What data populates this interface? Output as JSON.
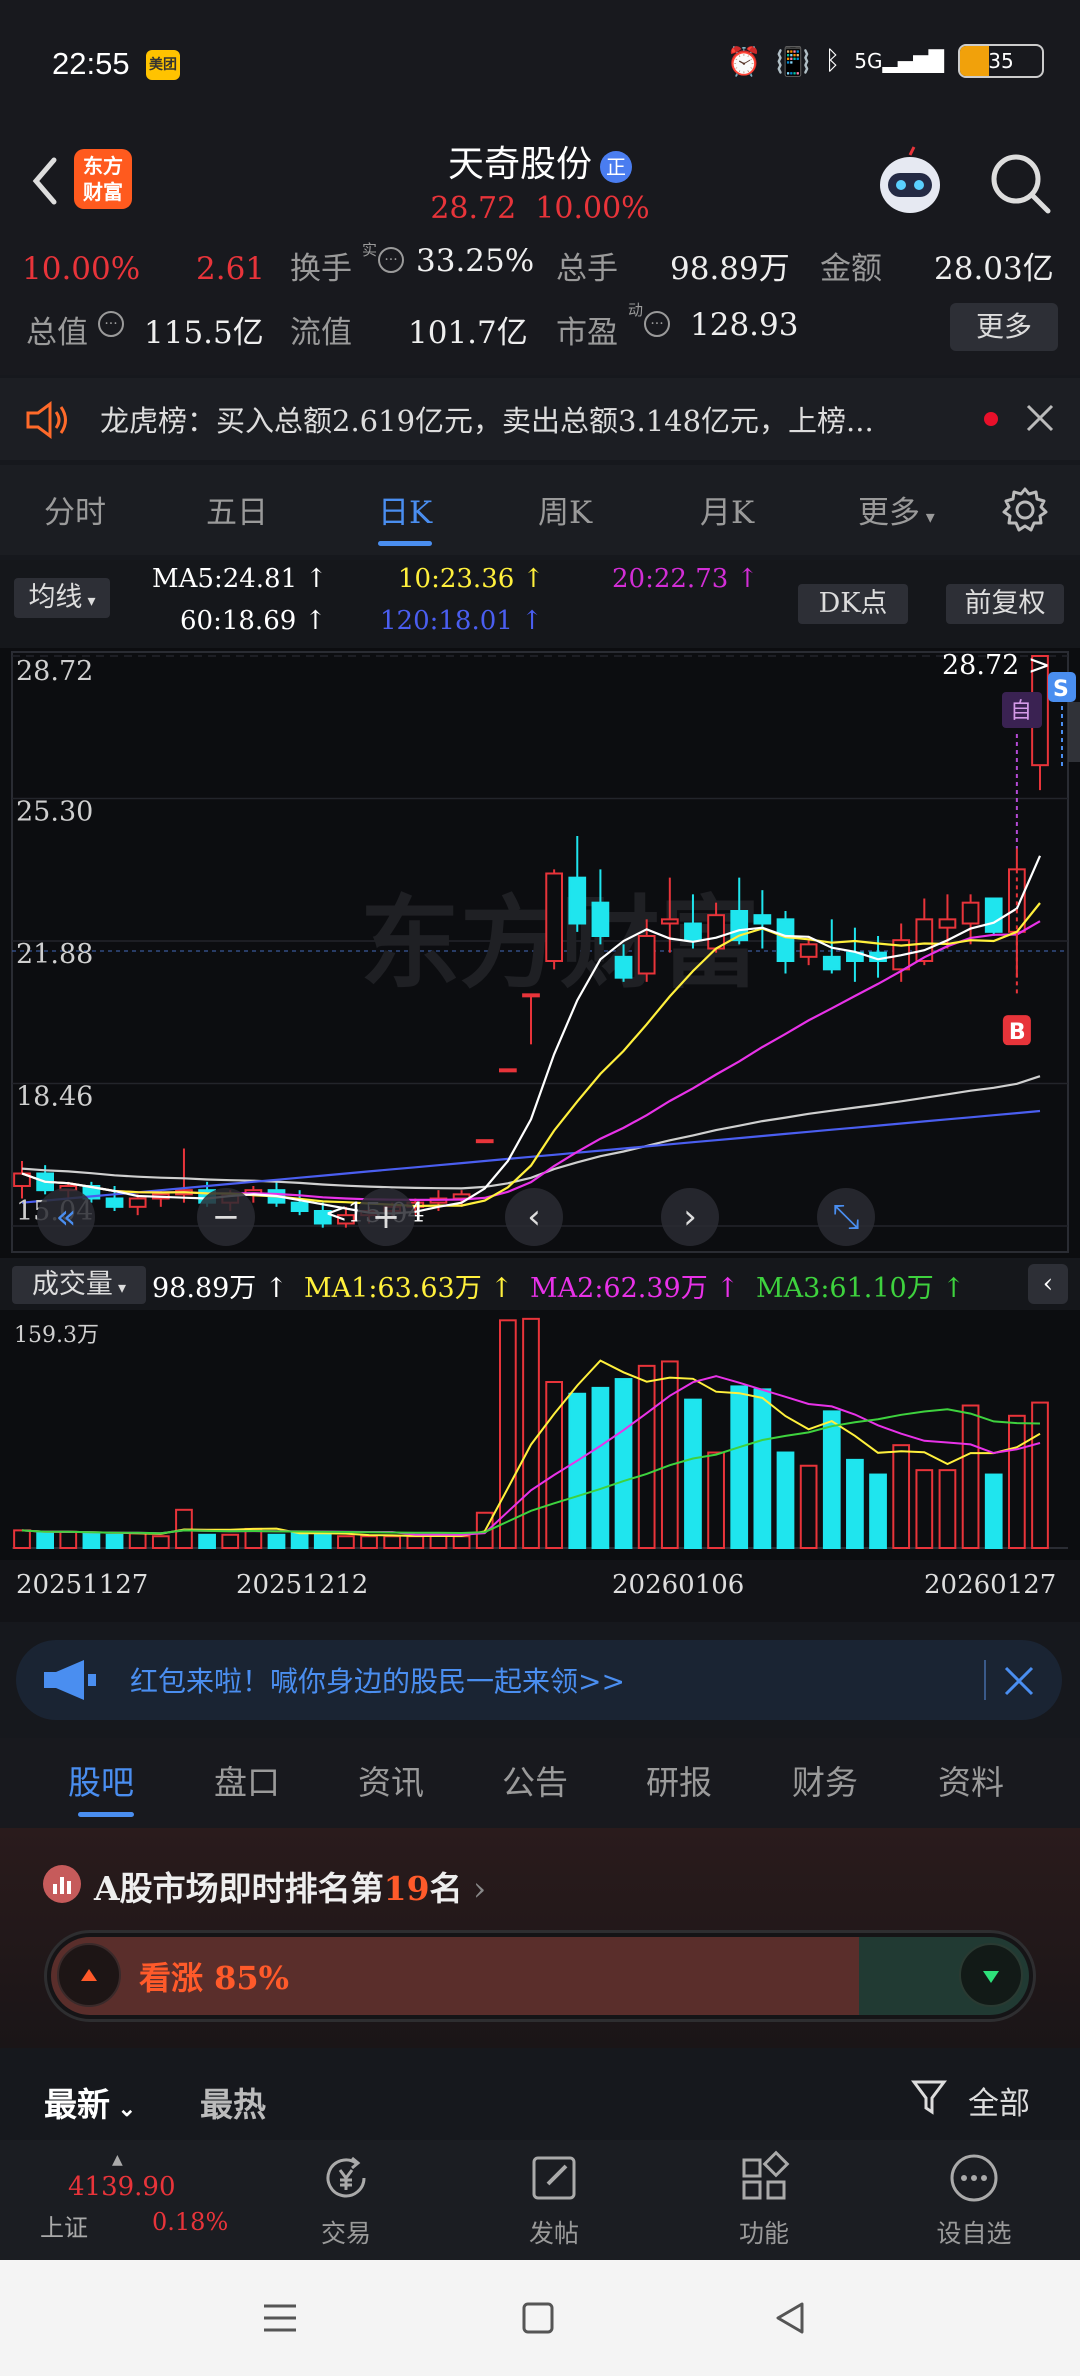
{
  "status": {
    "time": "22:55",
    "meituan": "美团",
    "network": "5G",
    "battery": "35"
  },
  "header": {
    "app_logo": "东方财富",
    "stock_name": "天奇股份",
    "badge": "正",
    "price": "28.72",
    "change_pct": "10.00%"
  },
  "quote": {
    "change_pct": "10.00%",
    "change": "2.61",
    "turnover_label": "换手",
    "turnover_sup": "实",
    "turnover": "33.25%",
    "volume_label": "总手",
    "volume": "98.89万",
    "amount_label": "金额",
    "amount": "28.03亿",
    "mktcap_label": "总值",
    "mktcap": "115.5亿",
    "float_label": "流值",
    "float": "101.7亿",
    "pe_label": "市盈",
    "pe_sup": "动",
    "pe": "128.93",
    "more": "更多"
  },
  "notice": {
    "text": "龙虎榜：买入总额2.619亿元，卖出总额3.148亿元，上榜..."
  },
  "tabs": [
    "分时",
    "五日",
    "日K",
    "周K",
    "月K",
    "更多"
  ],
  "active_tab": "日K",
  "ma": {
    "selector": "均线",
    "ma5": "MA5:24.81 ↑",
    "ma10": "10:23.36 ↑",
    "ma20": "20:22.73 ↑",
    "ma60": "60:18.69 ↑",
    "ma120": "120:18.01 ↑",
    "dk": "DK点",
    "adjust": "前复权"
  },
  "colors": {
    "ma5": "#ffffff",
    "ma10": "#fff03c",
    "ma20": "#e832e8",
    "ma60": "#cfcfcf",
    "ma120": "#4a5ef0",
    "up": "#e8343a",
    "down": "#1fe5ee",
    "vol_ma3": "#3ed23e"
  },
  "chart_data": [
    {
      "type": "candlestick",
      "y_ticks": [
        "28.72",
        "25.30",
        "21.88",
        "18.46",
        "15.04"
      ],
      "ylim": [
        15.04,
        28.72
      ],
      "last_price_label": "28.72",
      "low_label": "15.04",
      "badge_s": "S",
      "badge_b": "B",
      "badge_zi": "自",
      "candles": [
        [
          16.0,
          16.6,
          15.7,
          16.3
        ],
        [
          16.3,
          16.5,
          15.8,
          15.9
        ],
        [
          15.9,
          16.1,
          15.7,
          16.0
        ],
        [
          16.0,
          16.1,
          15.6,
          15.7
        ],
        [
          15.7,
          16.0,
          15.4,
          15.5
        ],
        [
          15.5,
          15.8,
          15.3,
          15.7
        ],
        [
          15.7,
          15.9,
          15.5,
          15.8
        ],
        [
          15.8,
          16.9,
          15.6,
          15.9
        ],
        [
          15.9,
          16.1,
          15.5,
          15.6
        ],
        [
          15.6,
          15.9,
          15.4,
          15.8
        ],
        [
          15.8,
          16.0,
          15.6,
          15.9
        ],
        [
          15.9,
          16.1,
          15.5,
          15.6
        ],
        [
          15.6,
          15.9,
          15.3,
          15.4
        ],
        [
          15.4,
          15.6,
          15.0,
          15.1
        ],
        [
          15.1,
          15.5,
          15.0,
          15.3
        ],
        [
          15.3,
          15.5,
          15.1,
          15.4
        ],
        [
          15.4,
          15.6,
          15.2,
          15.5
        ],
        [
          15.5,
          15.7,
          15.3,
          15.6
        ],
        [
          15.6,
          15.9,
          15.4,
          15.7
        ],
        [
          15.7,
          15.9,
          15.5,
          15.8
        ],
        [
          17.1,
          17.1,
          17.1,
          17.1
        ],
        [
          18.8,
          18.8,
          18.8,
          18.8
        ],
        [
          20.6,
          20.6,
          19.4,
          20.6
        ],
        [
          21.4,
          23.6,
          21.2,
          23.5
        ],
        [
          23.4,
          24.4,
          22.1,
          22.3
        ],
        [
          22.8,
          23.6,
          21.8,
          22.0
        ],
        [
          21.5,
          21.8,
          20.9,
          21.0
        ],
        [
          21.1,
          22.4,
          20.9,
          22.0
        ],
        [
          22.3,
          23.4,
          21.6,
          22.4
        ],
        [
          22.3,
          23.0,
          21.7,
          21.9
        ],
        [
          21.7,
          22.8,
          21.6,
          22.5
        ],
        [
          22.6,
          23.4,
          21.8,
          21.9
        ],
        [
          22.5,
          23.1,
          21.7,
          22.3
        ],
        [
          22.4,
          22.6,
          21.1,
          21.4
        ],
        [
          21.5,
          22.0,
          21.3,
          21.8
        ],
        [
          21.5,
          22.4,
          21.1,
          21.2
        ],
        [
          21.6,
          22.2,
          20.9,
          21.4
        ],
        [
          21.6,
          22.0,
          21.0,
          21.4
        ],
        [
          21.2,
          22.3,
          20.9,
          21.9
        ],
        [
          21.4,
          22.9,
          21.3,
          22.4
        ],
        [
          22.2,
          23.0,
          21.7,
          22.4
        ],
        [
          22.3,
          23.0,
          21.8,
          22.8
        ],
        [
          22.9,
          22.9,
          22.0,
          22.1
        ],
        [
          22.1,
          24.1,
          21.0,
          23.6
        ],
        [
          26.1,
          28.72,
          25.5,
          28.72
        ]
      ]
    },
    {
      "type": "bar",
      "title": "成交量",
      "legend": {
        "vol": "98.89万 ↑",
        "ma1": "MA1:63.63万 ↑",
        "ma2": "MA2:62.39万 ↑",
        "ma3": "MA3:61.10万 ↑"
      },
      "max_label": "159.3万",
      "ylim": [
        0,
        159.3
      ],
      "values": [
        12,
        10,
        11,
        10,
        9,
        10,
        8,
        26,
        9,
        9,
        13,
        9,
        10,
        9,
        8,
        8,
        8,
        8,
        9,
        8,
        24,
        155,
        156,
        113,
        105,
        109,
        115,
        124,
        127,
        101,
        65,
        110,
        108,
        65,
        56,
        93,
        60,
        50,
        70,
        53,
        53,
        97,
        50,
        90,
        99
      ],
      "dates": [
        "20251127",
        "20251212",
        "20260106",
        "20260127"
      ]
    }
  ],
  "promo": {
    "text": "红包来啦！喊你身边的股民一起来领>>"
  },
  "subtabs": [
    "股吧",
    "盘口",
    "资讯",
    "公告",
    "研报",
    "财务",
    "资料"
  ],
  "rank": {
    "prefix": "A股市场即时排名第",
    "rank": "19",
    "suffix": "名",
    "bullish": "看涨 85%",
    "bullish_ratio": 0.85
  },
  "sort": {
    "newest": "最新",
    "hottest": "最热",
    "filter": "全部"
  },
  "bottomnav": {
    "index_value": "4139.90",
    "index_name": "上证",
    "index_change": "0.18%",
    "items": [
      "交易",
      "发帖",
      "功能",
      "设自选"
    ]
  }
}
